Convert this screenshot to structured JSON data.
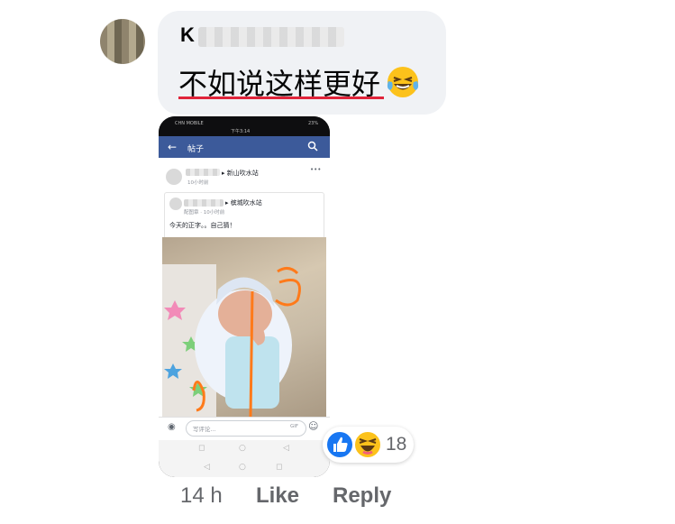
{
  "comment": {
    "author_initial": "K",
    "text": "不如说这样更好",
    "emoji": "laughing-tears-emoji"
  },
  "phone": {
    "status_left": "CHN MOBILE",
    "status_center": "下午3:14",
    "status_right": "23%",
    "appbar_title": "帖子",
    "post": {
      "page_name": "新山吹水站",
      "time": "10小时前",
      "shared_page": "槟城吹水站",
      "shared_meta": "配图章 · 10小时前",
      "text": "今天的正字。。自己猜！"
    },
    "compose_placeholder": "写评论..."
  },
  "reactions": {
    "count": "18"
  },
  "actions": {
    "time": "14 h",
    "like": "Like",
    "reply": "Reply"
  },
  "colors": {
    "bubble": "#f0f2f5",
    "text": "#050505",
    "meta": "#65676b",
    "underline": "#e0243a",
    "facebook_blue": "#3c5a9a",
    "like_blue": "#1877f2"
  }
}
